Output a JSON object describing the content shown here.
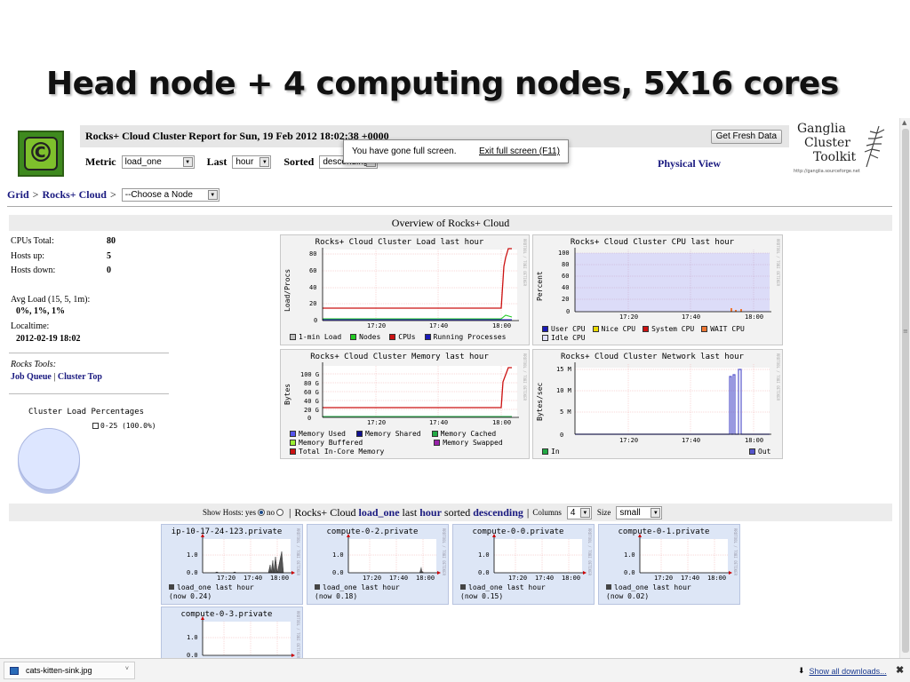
{
  "slide": {
    "title": "Head node + 4 computing nodes, 5X16 cores"
  },
  "header": {
    "report_title": "Rocks+ Cloud Cluster Report for Sun, 19 Feb 2012 18:02:38 +0000",
    "refresh_button": "Get Fresh Data",
    "metric_label": "Metric",
    "metric_value": "load_one",
    "last_label": "Last",
    "last_value": "hour",
    "sorted_label": "Sorted",
    "sorted_value": "descending",
    "physical_view": "Physical View",
    "logo_glyph": "©"
  },
  "ganglia_logo": {
    "line1": "Ganglia",
    "line2": "Cluster",
    "line3": "Toolkit",
    "url": "http://ganglia.sourceforge.net"
  },
  "fullscreen_toast": {
    "message": "You have gone full screen.",
    "exit_link": "Exit full screen (F11)"
  },
  "breadcrumb": {
    "grid": "Grid",
    "sep1": ">",
    "cloud": "Rocks+ Cloud",
    "sep2": ">",
    "node_select": "--Choose a Node"
  },
  "overview": {
    "title": "Overview of Rocks+ Cloud",
    "cpus_label": "CPUs Total:",
    "cpus_value": "80",
    "hosts_up_label": "Hosts up:",
    "hosts_up_value": "5",
    "hosts_down_label": "Hosts down:",
    "hosts_down_value": "0",
    "avg_load_label": "Avg Load (15, 5, 1m):",
    "avg_load_value": "0%, 1%, 1%",
    "localtime_label": "Localtime:",
    "localtime_value": "2012-02-19 18:02",
    "rocks_tools_label": "Rocks Tools:",
    "job_queue": "Job Queue",
    "tools_sep": "|",
    "cluster_top": "Cluster Top",
    "pie_title": "Cluster Load Percentages",
    "pie_legend": "0-25 (100.0%)"
  },
  "graphs": {
    "load": {
      "title": "Rocks+ Cloud Cluster Load last hour",
      "ylabel": "Load/Procs",
      "yticks": [
        "80",
        "60",
        "40",
        "20",
        "0"
      ],
      "xticks": [
        "17:20",
        "17:40",
        "18:00"
      ],
      "legend": [
        "1-min Load",
        "Nodes",
        "CPUs",
        "Running Processes"
      ],
      "colors": [
        "#c0c0c0",
        "#22cc22",
        "#cc1111",
        "#1a1ab8"
      ]
    },
    "cpu": {
      "title": "Rocks+ Cloud Cluster CPU last hour",
      "ylabel": "Percent",
      "yticks": [
        "100",
        "80",
        "60",
        "40",
        "20",
        "0"
      ],
      "xticks": [
        "17:20",
        "17:40",
        "18:00"
      ],
      "legend": [
        "User CPU",
        "Nice CPU",
        "System CPU",
        "WAIT CPU",
        "Idle CPU"
      ],
      "colors": [
        "#1a1ab8",
        "#e8d800",
        "#cc1111",
        "#ee7733",
        "#e0e0ff"
      ]
    },
    "memory": {
      "title": "Rocks+ Cloud Cluster Memory last hour",
      "ylabel": "Bytes",
      "yticks": [
        "100 G",
        "80 G",
        "60 G",
        "40 G",
        "20 G",
        "0"
      ],
      "xticks": [
        "17:20",
        "17:40",
        "18:00"
      ],
      "legend": [
        "Memory Used",
        "Memory Shared",
        "Memory Cached",
        "Memory Buffered",
        "Memory Swapped",
        "Total In-Core Memory"
      ],
      "colors": [
        "#5555ee",
        "#101090",
        "#22aa44",
        "#99ee33",
        "#9922aa",
        "#cc1111"
      ]
    },
    "network": {
      "title": "Rocks+ Cloud Cluster Network last hour",
      "ylabel": "Bytes/sec",
      "yticks": [
        "15 M",
        "10 M",
        "5 M",
        "0"
      ],
      "xticks": [
        "17:20",
        "17:40",
        "18:00"
      ],
      "legend": [
        "In",
        "Out"
      ],
      "colors": [
        "#22aa44",
        "#5555cc"
      ]
    },
    "side_text": "RRDTOOL / TOBI OETIKER"
  },
  "hosts_bar": {
    "show_hosts": "Show Hosts: yes",
    "no": "no",
    "sep": "|",
    "cluster": "Rocks+ Cloud",
    "metric": "load_one",
    "last_word": "last",
    "range": "hour",
    "sorted_word": "sorted",
    "order": "descending",
    "sep2": "|",
    "columns_label": "Columns",
    "columns_value": "4",
    "size_label": "Size",
    "size_value": "small"
  },
  "hosts": [
    {
      "name": "ip-10-17-24-123.private",
      "legend": "load_one last hour",
      "now": "(now 0.24)"
    },
    {
      "name": "compute-0-2.private",
      "legend": "load_one last hour",
      "now": "(now 0.18)"
    },
    {
      "name": "compute-0-0.private",
      "legend": "load_one last hour",
      "now": "(now 0.15)"
    },
    {
      "name": "compute-0-1.private",
      "legend": "load_one last hour",
      "now": "(now 0.02)"
    },
    {
      "name": "compute-0-3.private",
      "legend": "",
      "now": ""
    }
  ],
  "host_ticks": {
    "y1": "1.0",
    "y0": "0.0",
    "x": [
      "17:20",
      "17:40",
      "18:00"
    ]
  },
  "downloads": {
    "file": "cats-kitten-sink.jpg",
    "show_all": "Show all downloads...",
    "close": "✖"
  }
}
